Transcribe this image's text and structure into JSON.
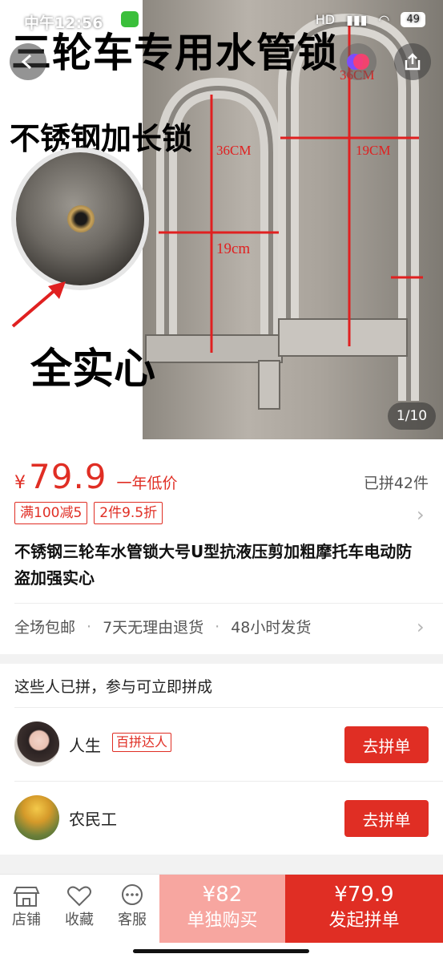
{
  "status_bar": {
    "time": "中午12:56",
    "network": "HD",
    "battery": "49"
  },
  "hero": {
    "title": "三轮车专用水管锁",
    "subtitle": "不锈钢加长锁",
    "solid": "全实心",
    "measure_left_height": "36CM",
    "measure_left_width": "19cm",
    "measure_right_height": "36CM",
    "measure_right_width": "19CM",
    "counter": "1/10"
  },
  "price": {
    "currency": "¥",
    "value": "79.9",
    "tag": "一年低价",
    "sold": "已拼42件"
  },
  "promos": [
    "满100减5",
    "2件9.5折"
  ],
  "product_title": "不锈钢三轮车水管锁大号U型抗液压剪加粗摩托车电动防盗加强实心",
  "services": [
    "全场包邮",
    "7天无理由退货",
    "48小时发货"
  ],
  "group": {
    "heading": "这些人已拼，参与可立即拼成",
    "members": [
      {
        "name": "人生",
        "badge": "百拼达人",
        "button": "去拼单"
      },
      {
        "name": "农民工",
        "badge": "",
        "button": "去拼单"
      }
    ]
  },
  "bottom_bar": {
    "tabs": [
      {
        "label": "店铺",
        "icon": "store-icon"
      },
      {
        "label": "收藏",
        "icon": "heart-icon"
      },
      {
        "label": "客服",
        "icon": "chat-icon"
      }
    ],
    "buy_alone_price": "¥82",
    "buy_alone_label": "单独购买",
    "buy_group_price": "¥79.9",
    "buy_group_label": "发起拼单"
  },
  "colors": {
    "accent": "#e02e24",
    "accent_light": "#f7a6a0"
  }
}
